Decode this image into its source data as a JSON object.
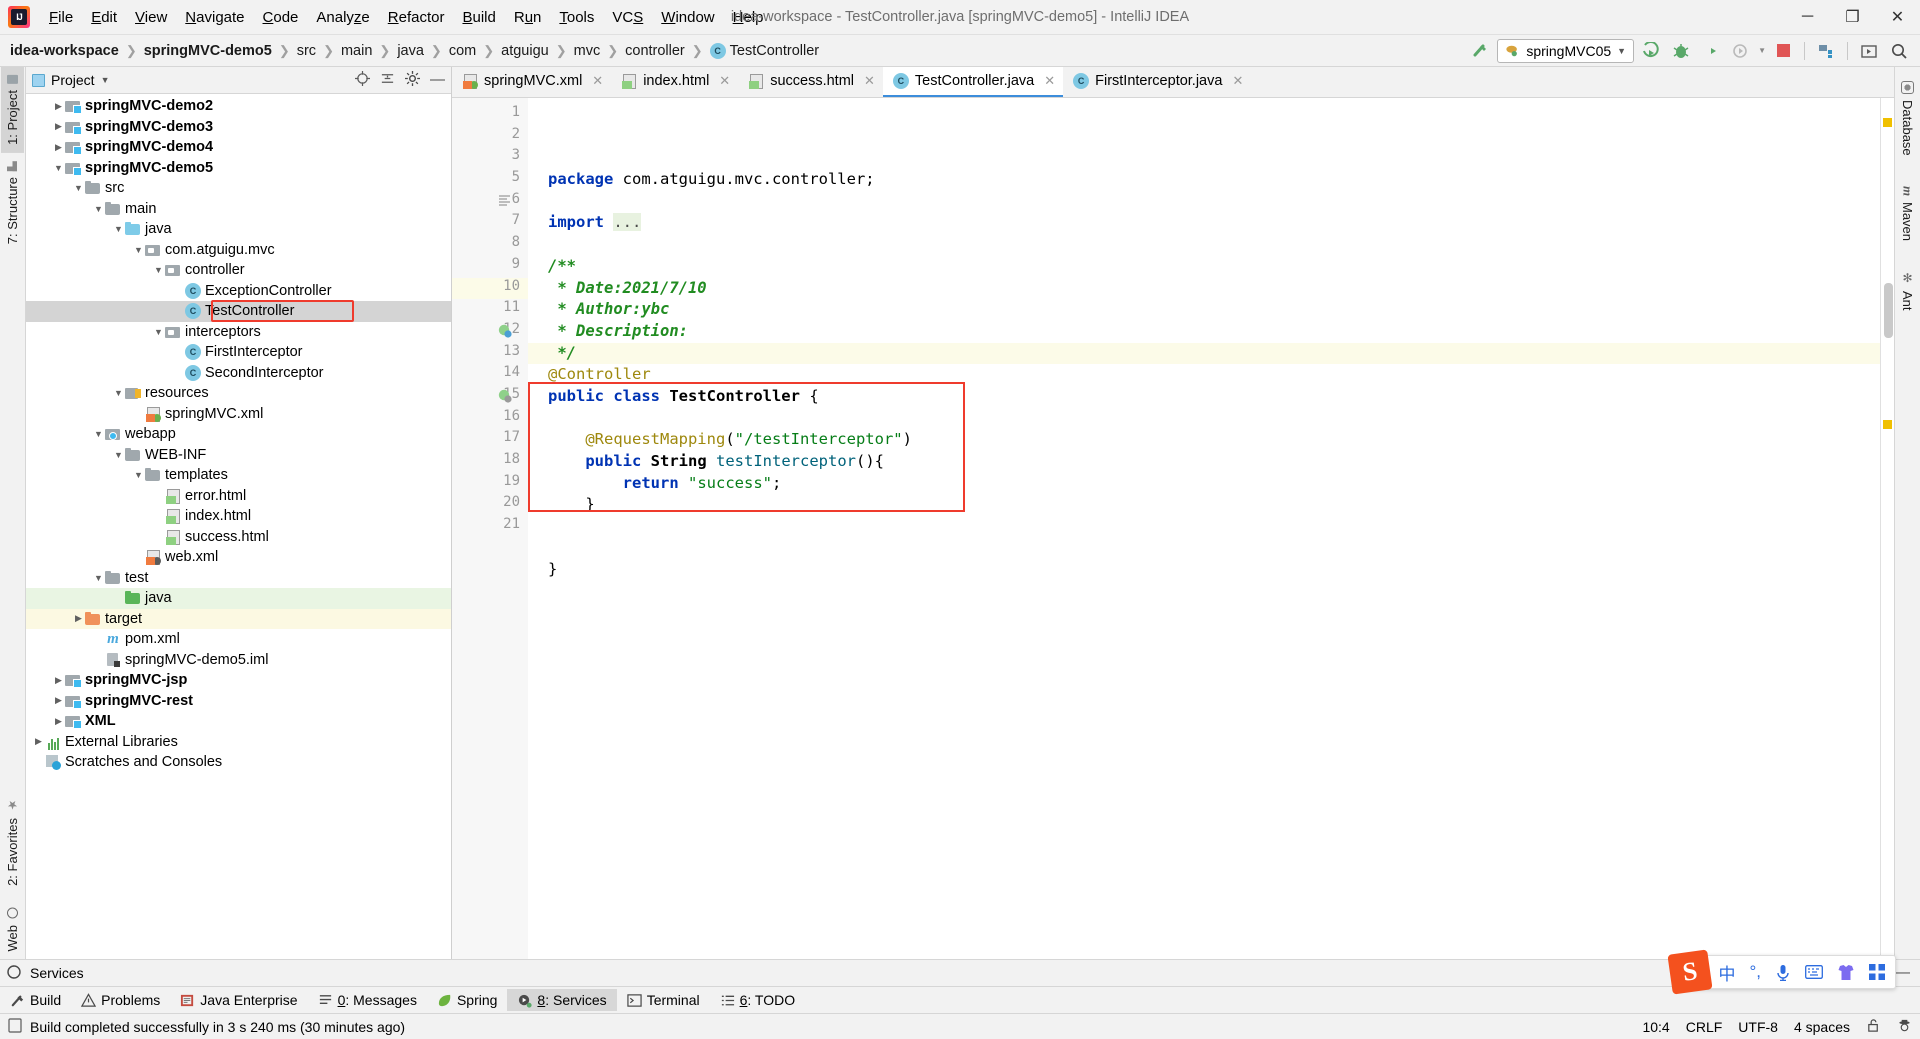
{
  "window": {
    "title": "idea-workspace - TestController.java [springMVC-demo5] - IntelliJ IDEA",
    "minimize": "─",
    "maximize": "❐",
    "close": "✕"
  },
  "menu": [
    {
      "label": "File"
    },
    {
      "label": "Edit"
    },
    {
      "label": "View"
    },
    {
      "label": "Navigate"
    },
    {
      "label": "Code"
    },
    {
      "label": "Analyze"
    },
    {
      "label": "Refactor"
    },
    {
      "label": "Build"
    },
    {
      "label": "Run"
    },
    {
      "label": "Tools"
    },
    {
      "label": "VCS"
    },
    {
      "label": "Window"
    },
    {
      "label": "Help"
    }
  ],
  "breadcrumb": [
    {
      "label": "idea-workspace",
      "bold": true
    },
    {
      "label": "springMVC-demo5",
      "bold": true
    },
    {
      "label": "src",
      "bold": false
    },
    {
      "label": "main",
      "bold": false
    },
    {
      "label": "java",
      "bold": false
    },
    {
      "label": "com",
      "bold": false
    },
    {
      "label": "atguigu",
      "bold": false
    },
    {
      "label": "mvc",
      "bold": false
    },
    {
      "label": "controller",
      "bold": false
    },
    {
      "label": "TestController",
      "bold": false
    }
  ],
  "toolbar": {
    "run_config": "springMVC05",
    "dropdown_caret": "▼",
    "icons": [
      "build-hammer-icon",
      "run-icon",
      "debug-icon",
      "run-with-coverage-icon",
      "profiler-icon",
      "stop-icon",
      "project-structure-icon",
      "open-preview-icon",
      "search-everywhere-icon"
    ]
  },
  "left_strip": [
    {
      "label": "1: Project",
      "active": true,
      "icon": "folder-icon"
    },
    {
      "label": "7: Structure",
      "active": false,
      "icon": "structure-icon"
    }
  ],
  "left_strip_bottom": [
    {
      "label": "2: Favorites",
      "icon": "star-icon"
    },
    {
      "label": "Web",
      "icon": "globe-icon"
    }
  ],
  "right_strip": [
    {
      "label": "Database",
      "icon": "database-icon"
    },
    {
      "label": "Maven",
      "icon": "maven-icon"
    },
    {
      "label": "Ant",
      "icon": "ant-icon"
    }
  ],
  "project_panel": {
    "title": "Project",
    "caret": "▼",
    "actions": [
      "locate-icon",
      "collapse-all-icon",
      "settings-gear-icon",
      "hide-icon"
    ],
    "tree": [
      {
        "label": "springMVC-demo2",
        "indent": 1,
        "arrow": "▶",
        "icon": "module",
        "bold": true,
        "state": ""
      },
      {
        "label": "springMVC-demo3",
        "indent": 1,
        "arrow": "▶",
        "icon": "module",
        "bold": true,
        "state": ""
      },
      {
        "label": "springMVC-demo4",
        "indent": 1,
        "arrow": "▶",
        "icon": "module",
        "bold": true,
        "state": ""
      },
      {
        "label": "springMVC-demo5",
        "indent": 1,
        "arrow": "▼",
        "icon": "module",
        "bold": true,
        "state": ""
      },
      {
        "label": "src",
        "indent": 2,
        "arrow": "▼",
        "icon": "folder",
        "bold": false,
        "state": ""
      },
      {
        "label": "main",
        "indent": 3,
        "arrow": "▼",
        "icon": "folder",
        "bold": false,
        "state": ""
      },
      {
        "label": "java",
        "indent": 4,
        "arrow": "▼",
        "icon": "folder-blue",
        "bold": false,
        "state": ""
      },
      {
        "label": "com.atguigu.mvc",
        "indent": 5,
        "arrow": "▼",
        "icon": "pkg",
        "bold": false,
        "state": ""
      },
      {
        "label": "controller",
        "indent": 6,
        "arrow": "▼",
        "icon": "pkg",
        "bold": false,
        "state": ""
      },
      {
        "label": "ExceptionController",
        "indent": 7,
        "arrow": "",
        "icon": "class",
        "bold": false,
        "state": ""
      },
      {
        "label": "TestController",
        "indent": 7,
        "arrow": "",
        "icon": "class",
        "bold": false,
        "state": "selected"
      },
      {
        "label": "interceptors",
        "indent": 6,
        "arrow": "▼",
        "icon": "pkg",
        "bold": false,
        "state": ""
      },
      {
        "label": "FirstInterceptor",
        "indent": 7,
        "arrow": "",
        "icon": "class",
        "bold": false,
        "state": ""
      },
      {
        "label": "SecondInterceptor",
        "indent": 7,
        "arrow": "",
        "icon": "class",
        "bold": false,
        "state": ""
      },
      {
        "label": "resources",
        "indent": 4,
        "arrow": "▼",
        "icon": "resources",
        "bold": false,
        "state": ""
      },
      {
        "label": "springMVC.xml",
        "indent": 5,
        "arrow": "",
        "icon": "xml-spring",
        "bold": false,
        "state": ""
      },
      {
        "label": "webapp",
        "indent": 3,
        "arrow": "▼",
        "icon": "webapp",
        "bold": false,
        "state": ""
      },
      {
        "label": "WEB-INF",
        "indent": 4,
        "arrow": "▼",
        "icon": "folder",
        "bold": false,
        "state": ""
      },
      {
        "label": "templates",
        "indent": 5,
        "arrow": "▼",
        "icon": "folder",
        "bold": false,
        "state": ""
      },
      {
        "label": "error.html",
        "indent": 6,
        "arrow": "",
        "icon": "html",
        "bold": false,
        "state": ""
      },
      {
        "label": "index.html",
        "indent": 6,
        "arrow": "",
        "icon": "html",
        "bold": false,
        "state": ""
      },
      {
        "label": "success.html",
        "indent": 6,
        "arrow": "",
        "icon": "html",
        "bold": false,
        "state": ""
      },
      {
        "label": "web.xml",
        "indent": 5,
        "arrow": "",
        "icon": "xml-web",
        "bold": false,
        "state": ""
      },
      {
        "label": "test",
        "indent": 3,
        "arrow": "▼",
        "icon": "folder",
        "bold": false,
        "state": ""
      },
      {
        "label": "java",
        "indent": 4,
        "arrow": "",
        "icon": "folder-green",
        "bold": false,
        "state": "green"
      },
      {
        "label": "target",
        "indent": 2,
        "arrow": "▶",
        "icon": "folder-orange",
        "bold": false,
        "state": "yellow"
      },
      {
        "label": "pom.xml",
        "indent": 3,
        "arrow": "",
        "icon": "maven",
        "bold": false,
        "state": ""
      },
      {
        "label": "springMVC-demo5.iml",
        "indent": 3,
        "arrow": "",
        "icon": "iml",
        "bold": false,
        "state": ""
      },
      {
        "label": "springMVC-jsp",
        "indent": 1,
        "arrow": "▶",
        "icon": "module",
        "bold": true,
        "state": ""
      },
      {
        "label": "springMVC-rest",
        "indent": 1,
        "arrow": "▶",
        "icon": "module",
        "bold": true,
        "state": ""
      },
      {
        "label": "XML",
        "indent": 1,
        "arrow": "▶",
        "icon": "module",
        "bold": true,
        "state": ""
      },
      {
        "label": "External Libraries",
        "indent": 0,
        "arrow": "▶",
        "icon": "extlib",
        "bold": false,
        "state": ""
      },
      {
        "label": "Scratches and Consoles",
        "indent": 0,
        "arrow": "",
        "icon": "scratch",
        "bold": false,
        "state": ""
      }
    ]
  },
  "editor": {
    "tabs": [
      {
        "label": "springMVC.xml",
        "icon": "xml-spring-icon",
        "active": false,
        "close": "✕"
      },
      {
        "label": "index.html",
        "icon": "html-icon",
        "active": false,
        "close": "✕"
      },
      {
        "label": "success.html",
        "icon": "html-icon",
        "active": false,
        "close": "✕"
      },
      {
        "label": "TestController.java",
        "icon": "java-class-icon",
        "active": true,
        "close": "✕"
      },
      {
        "label": "FirstInterceptor.java",
        "icon": "java-class-icon",
        "active": false,
        "close": "✕"
      }
    ],
    "line_numbers": [
      "1",
      "2",
      "3",
      "5",
      "6",
      "7",
      "8",
      "9",
      "10",
      "11",
      "12",
      "13",
      "14",
      "15",
      "16",
      "17",
      "18",
      "19",
      "20",
      "21"
    ],
    "current_line_index": 8,
    "lines": [
      {
        "n": "1",
        "html": "<span class='kw'>package</span> com.atguigu.mvc.controller;"
      },
      {
        "n": "2",
        "html": ""
      },
      {
        "n": "3",
        "html": "<span class='kw'>import</span> <span style='background:#e8f2e0;color:#4a4a4a'>...</span>"
      },
      {
        "n": "5",
        "html": ""
      },
      {
        "n": "6",
        "html": "<span class='jdoc'>/**</span>"
      },
      {
        "n": "7",
        "html": "<span class='jdoc'>&nbsp;* Date:2021/7/10</span>"
      },
      {
        "n": "8",
        "html": "<span class='jdoc'>&nbsp;* Author:ybc</span>"
      },
      {
        "n": "9",
        "html": "<span class='jdoc'>&nbsp;* Description:</span>"
      },
      {
        "n": "10",
        "html": "<span class='jdoc'>&nbsp;*/</span>"
      },
      {
        "n": "11",
        "html": "<span class='anno'>@Controller</span>"
      },
      {
        "n": "12",
        "html": "<span class='kw'>public class</span> <span class='typ'>TestController</span> {"
      },
      {
        "n": "13",
        "html": ""
      },
      {
        "n": "14",
        "html": "    <span class='anno'>@RequestMapping</span>(<span class='str'>\"/testInterceptor\"</span>)"
      },
      {
        "n": "15",
        "html": "    <span class='kw'>public</span> <span class='typ'>String</span> <span class='mth'>testInterceptor</span>(){"
      },
      {
        "n": "16",
        "html": "        <span class='kw'>return</span> <span class='str'>\"success\"</span>;"
      },
      {
        "n": "17",
        "html": "    }"
      },
      {
        "n": "18",
        "html": ""
      },
      {
        "n": "19",
        "html": ""
      },
      {
        "n": "20",
        "html": "}"
      },
      {
        "n": "21",
        "html": ""
      }
    ],
    "plain_lines": [
      "package com.atguigu.mvc.controller;",
      "",
      "import ...",
      "",
      "/**",
      " * Date:2021/7/10",
      " * Author:ybc",
      " * Description:",
      " */",
      "@Controller",
      "public class TestController {",
      "",
      "    @RequestMapping(\"/testInterceptor\")",
      "    public String testInterceptor(){",
      "        return \"success\";",
      "    }",
      "",
      "",
      "}",
      ""
    ]
  },
  "services": {
    "title": "Services",
    "right_icons": [
      "settings-gear-icon",
      "hide-icon",
      "locate-icon"
    ]
  },
  "tool_windows": [
    {
      "label": "Build",
      "icon": "build-hammer-icon",
      "active": false
    },
    {
      "label": "Problems",
      "icon": "warning-icon",
      "active": false
    },
    {
      "label": "Java Enterprise",
      "icon": "java-enterprise-icon",
      "active": false
    },
    {
      "label": "0: Messages",
      "icon": "messages-icon",
      "active": false
    },
    {
      "label": "Spring",
      "icon": "spring-leaf-icon",
      "active": false
    },
    {
      "label": "8: Services",
      "icon": "services-icon",
      "active": true
    },
    {
      "label": "Terminal",
      "icon": "terminal-icon",
      "active": false
    },
    {
      "label": "6: TODO",
      "icon": "todo-icon",
      "active": false
    }
  ],
  "status_bar": {
    "message": "Build completed successfully in 3 s 240 ms (30 minutes ago)",
    "message_icon": "document-icon",
    "caret_position": "10:4",
    "line_separator": "CRLF",
    "encoding": "UTF-8",
    "indent": "4 spaces",
    "lock_icon": "unlocked-icon",
    "inspector_icon": "hector-icon"
  },
  "ime_tray": {
    "logo": "S",
    "items": [
      "中",
      "°,",
      "mic-icon",
      "keyboard-icon",
      "skin-icon",
      "apps-icon"
    ]
  },
  "colors": {
    "accent_blue": "#3c8ddb",
    "highlight_red": "#ef3b2d",
    "selection_gray": "#d4d4d4",
    "current_line": "#fcfbe8",
    "keyword": "#0033b3",
    "string": "#067d17",
    "annotation": "#9e880d",
    "javadoc": "#218c21"
  }
}
